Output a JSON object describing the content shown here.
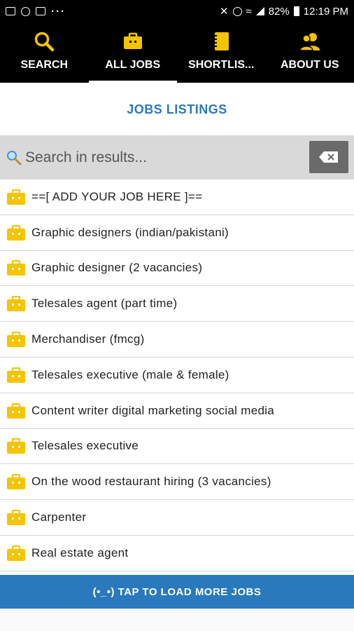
{
  "status_bar": {
    "battery": "82%",
    "time": "12:19 PM",
    "dots": "···"
  },
  "tabs": [
    {
      "label": "SEARCH",
      "icon": "search-icon",
      "active": false
    },
    {
      "label": "ALL JOBS",
      "icon": "briefcase-icon",
      "active": true
    },
    {
      "label": "SHORTLIS...",
      "icon": "notebook-icon",
      "active": false
    },
    {
      "label": "ABOUT US",
      "icon": "users-icon",
      "active": false
    }
  ],
  "colors": {
    "accent": "#2a79bd",
    "tab_icon": "#f5c400",
    "bag": "#f5c400"
  },
  "page_title": "JOBS LISTINGS",
  "search": {
    "placeholder": "Search in results..."
  },
  "jobs": [
    "==[ ADD YOUR JOB HERE ]==",
    "Graphic designers (indian/pakistani)",
    "Graphic designer (2 vacancies)",
    "Telesales agent (part time)",
    "Merchandiser (fmcg)",
    "Telesales executive (male & female)",
    "Content writer digital marketing social media",
    "Telesales executive",
    "On the wood restaurant hiring (3 vacancies)",
    "Carpenter",
    "Real estate agent"
  ],
  "load_more": "(•_•) TAP TO LOAD MORE JOBS"
}
